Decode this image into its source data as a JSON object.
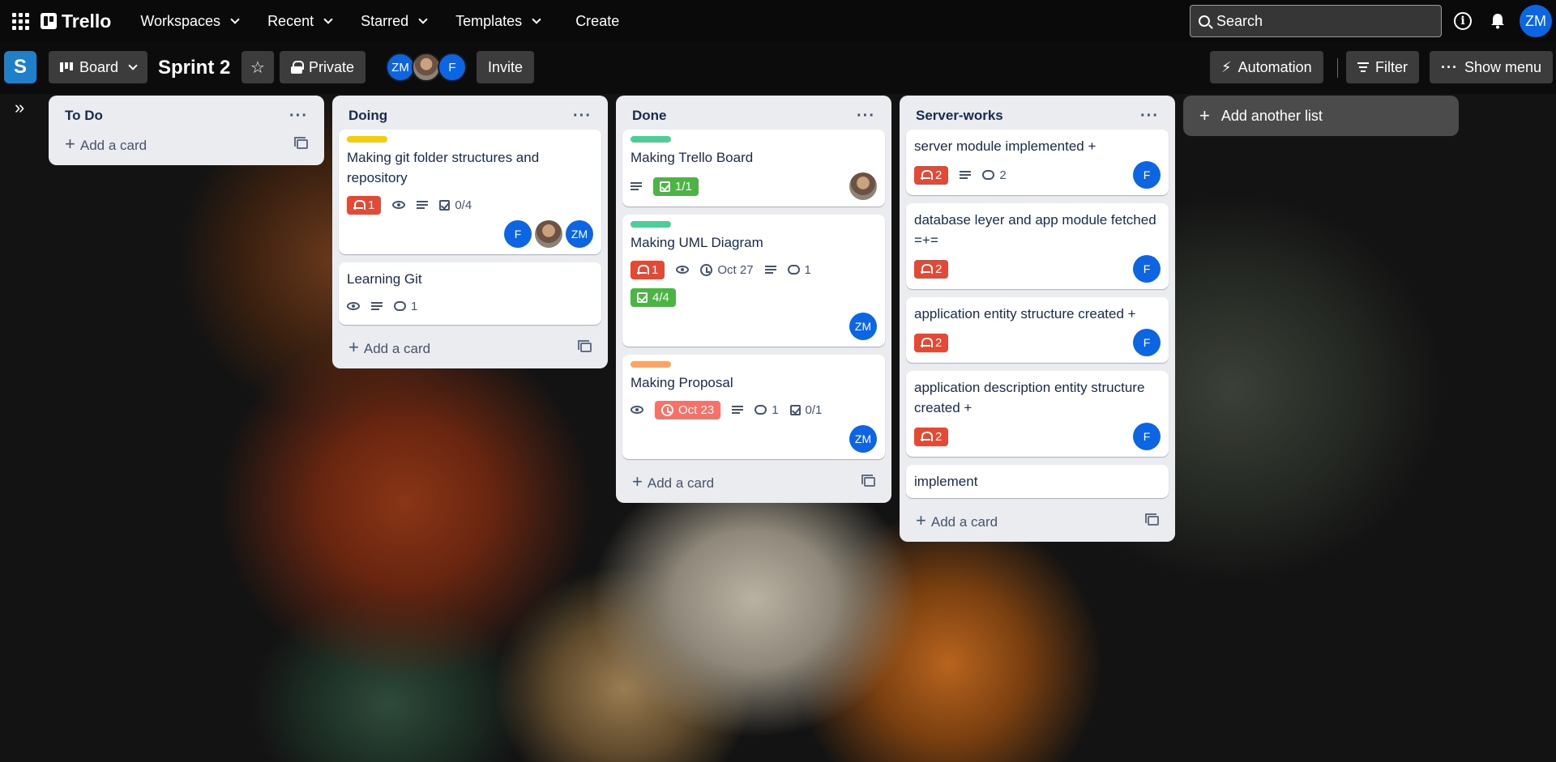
{
  "topbar": {
    "logo": "Trello",
    "nav": [
      "Workspaces",
      "Recent",
      "Starred",
      "Templates"
    ],
    "create": "Create",
    "search_placeholder": "Search",
    "user_initials": "ZM"
  },
  "boardbar": {
    "workspace_letter": "S",
    "view": "Board",
    "title": "Sprint 2",
    "visibility": "Private",
    "members": [
      "ZM",
      "",
      "F"
    ],
    "invite": "Invite",
    "automation": "Automation",
    "filter": "Filter",
    "show_menu": "Show menu"
  },
  "add_card_label": "Add a card",
  "add_list_label": "Add another list",
  "lists": [
    {
      "name": "To Do",
      "cards": []
    },
    {
      "name": "Doing",
      "cards": [
        {
          "label_color": "#f5cd09",
          "title": "Making git folder structures and repository",
          "notifications": "1",
          "checklist": "0/4",
          "members": [
            "F",
            "",
            "ZM"
          ]
        },
        {
          "title": "Learning Git",
          "comments": "1"
        }
      ]
    },
    {
      "name": "Done",
      "cards": [
        {
          "label_color": "#4bce97",
          "title": "Making Trello Board",
          "checklist": "1/1"
        },
        {
          "label_color": "#4bce97",
          "title": "Making UML Diagram",
          "notifications": "1",
          "due": "Oct 27",
          "comments": "1",
          "checklist": "4/4",
          "members": [
            "ZM"
          ]
        },
        {
          "label_color": "#fea362",
          "title": "Making Proposal",
          "due": "Oct 23",
          "comments": "1",
          "checklist": "0/1",
          "members": [
            "ZM"
          ]
        }
      ]
    },
    {
      "name": "Server-works",
      "cards": [
        {
          "title": "server module implemented +",
          "notifications": "2",
          "comments": "2",
          "members": [
            "F"
          ]
        },
        {
          "title": "database leyer and app module fetched =+=",
          "notifications": "2",
          "members": [
            "F"
          ]
        },
        {
          "title": "application entity structure created +",
          "notifications": "2",
          "members": [
            "F"
          ]
        },
        {
          "title": "application description entity structure created +",
          "notifications": "2",
          "members": [
            "F"
          ]
        },
        {
          "title": "implement"
        }
      ]
    }
  ]
}
